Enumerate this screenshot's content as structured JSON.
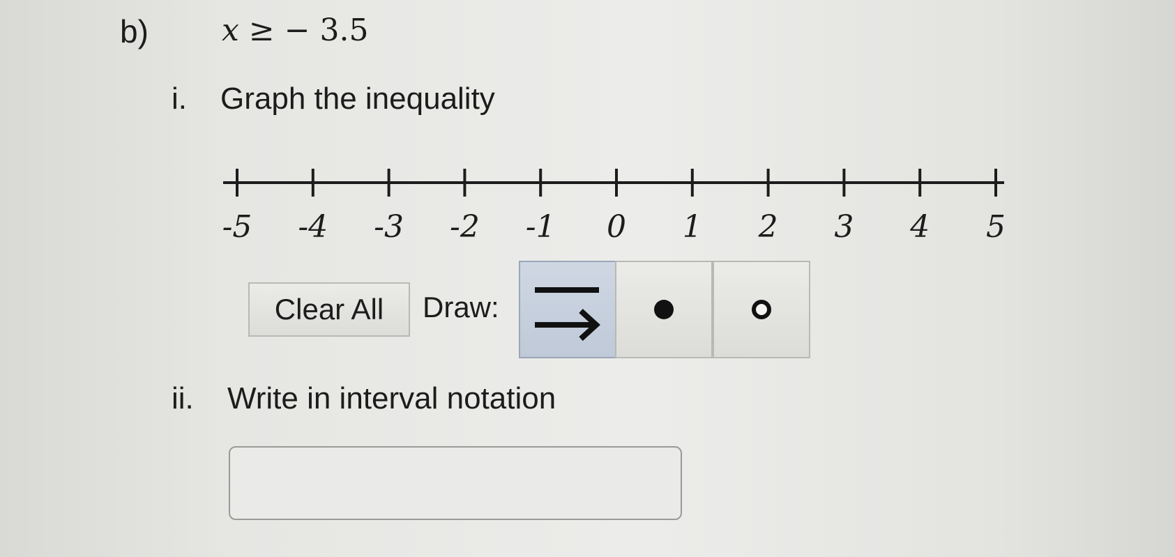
{
  "problem": {
    "part_label": "b)",
    "inequality": {
      "variable": "x",
      "operator": "≥",
      "value": "− 3.5"
    }
  },
  "step1": {
    "number": "i.",
    "text": "Graph the inequality"
  },
  "number_line": {
    "min": -5,
    "max": 5,
    "tick_labels": [
      "-5",
      "-4",
      "-3",
      "-2",
      "-1",
      "0",
      "1",
      "2",
      "3",
      "4",
      "5"
    ]
  },
  "toolbar": {
    "clear_label": "Clear All",
    "draw_label": "Draw:",
    "tools": [
      {
        "name": "ray-tool",
        "icon": "line-and-right-arrow-icon",
        "selected": true
      },
      {
        "name": "closed-point-tool",
        "icon": "filled-dot-icon",
        "selected": false
      },
      {
        "name": "open-point-tool",
        "icon": "open-circle-icon",
        "selected": false
      }
    ]
  },
  "step2": {
    "number": "ii.",
    "text": "Write in interval notation"
  },
  "answer_input": {
    "value": "",
    "placeholder": ""
  }
}
